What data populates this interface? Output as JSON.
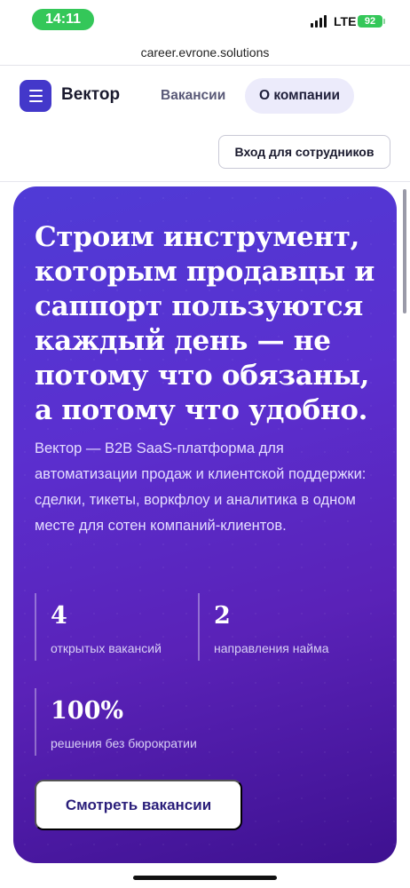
{
  "status_bar": {
    "time": "14:11",
    "network": "LTE",
    "battery": "92"
  },
  "browser": {
    "url": "career.evrone.solutions"
  },
  "header": {
    "brand": "Вектор",
    "nav": [
      {
        "label": "Вакансии",
        "active": false
      },
      {
        "label": "О компании",
        "active": true
      }
    ],
    "login_label": "Вход для сотрудников"
  },
  "hero": {
    "title": "Строим инструмент, которым продавцы и саппорт пользуются каждый день — не потому что обязаны, а потому что удобно.",
    "description": "Вектор — B2B SaaS-платформа для автоматизации продаж и клиентской поддержки: сделки, тикеты, воркфлоу и аналитика в одном месте для сотен компаний-клиентов.",
    "stats": [
      {
        "value": "4",
        "label": "открытых вакансий"
      },
      {
        "value": "2",
        "label": "направления найма"
      },
      {
        "value": "100%",
        "label": "решения без бюрократии"
      }
    ],
    "cta_label": "Смотреть вакансии"
  },
  "colors": {
    "accent": "#4338ca",
    "hero_gradient_start": "#4f3bd6",
    "hero_gradient_end": "#3e1190",
    "status_green": "#34c759"
  },
  "icons": {
    "menu": "hamburger-menu-icon",
    "signal": "cellular-signal-icon",
    "battery": "battery-icon"
  }
}
